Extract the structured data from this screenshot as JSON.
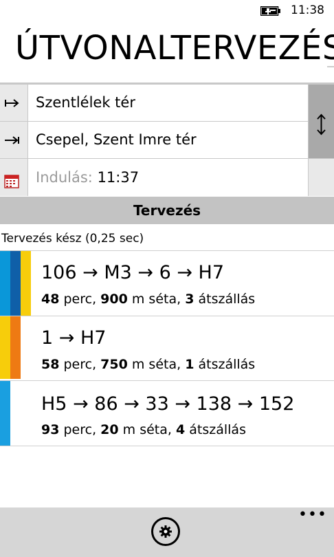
{
  "status_bar": {
    "time": "11:38",
    "battery_icon": "battery-charging-icon"
  },
  "header": {
    "title": "ÚTVONALTERVEZÉS"
  },
  "form": {
    "from": {
      "icon": "from-arrow-icon",
      "value": "Szentlélek tér"
    },
    "to": {
      "icon": "to-arrow-icon",
      "value": "Csepel, Szent Imre tér"
    },
    "departure": {
      "icon": "calendar-icon",
      "label": "Indulás:",
      "value": "11:37"
    },
    "swap_icon": "swap-vertical-icon"
  },
  "plan_button": {
    "label": "Tervezés"
  },
  "plan_status": "Tervezés kész (0,25 sec)",
  "routes": [
    {
      "chain": "106 → M3 → 6 → H7",
      "minutes": "48",
      "minutes_unit": " perc, ",
      "walk": "900",
      "walk_unit": " m séta, ",
      "transfers": "3",
      "transfers_unit": " átszállás",
      "colors": [
        "#0a97d9",
        "#0f5fa8",
        "#f7cd0b"
      ]
    },
    {
      "chain": "1 → H7",
      "minutes": "58",
      "minutes_unit": " perc, ",
      "walk": "750",
      "walk_unit": " m séta, ",
      "transfers": "1",
      "transfers_unit": " átszállás",
      "colors": [
        "#f7cd0b",
        "#ee7a13"
      ]
    },
    {
      "chain": "H5 → 86 → 33 → 138 → 152",
      "minutes": "93",
      "minutes_unit": " perc, ",
      "walk": "20",
      "walk_unit": " m séta, ",
      "transfers": "4",
      "transfers_unit": " átszállás",
      "colors": [
        "#1a9fe0"
      ]
    }
  ],
  "app_bar": {
    "settings_icon": "gear-icon",
    "more_label": "•••"
  }
}
